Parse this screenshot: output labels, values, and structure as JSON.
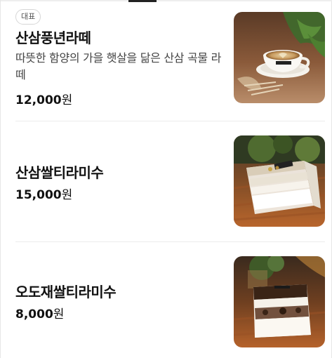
{
  "menu": {
    "items": [
      {
        "badge": "대표",
        "name": "산삼풍년라떼",
        "description": "따뜻한 함양의 가을 햇살을 닮은 산삼 곡물 라떼",
        "price_number": "12,000",
        "price_unit": "원",
        "image": "latte-cup-photo"
      },
      {
        "name": "산삼쌀티라미수",
        "price_number": "15,000",
        "price_unit": "원",
        "image": "tiramisu-box-photo"
      },
      {
        "name": "오도재쌀티라미수",
        "price_number": "8,000",
        "price_unit": "원",
        "image": "tiramisu-cup-photo"
      }
    ]
  },
  "colors": {
    "text": "#111111",
    "subtext": "#444444",
    "divider": "#ececec",
    "badge_border": "#d6d6d6"
  }
}
